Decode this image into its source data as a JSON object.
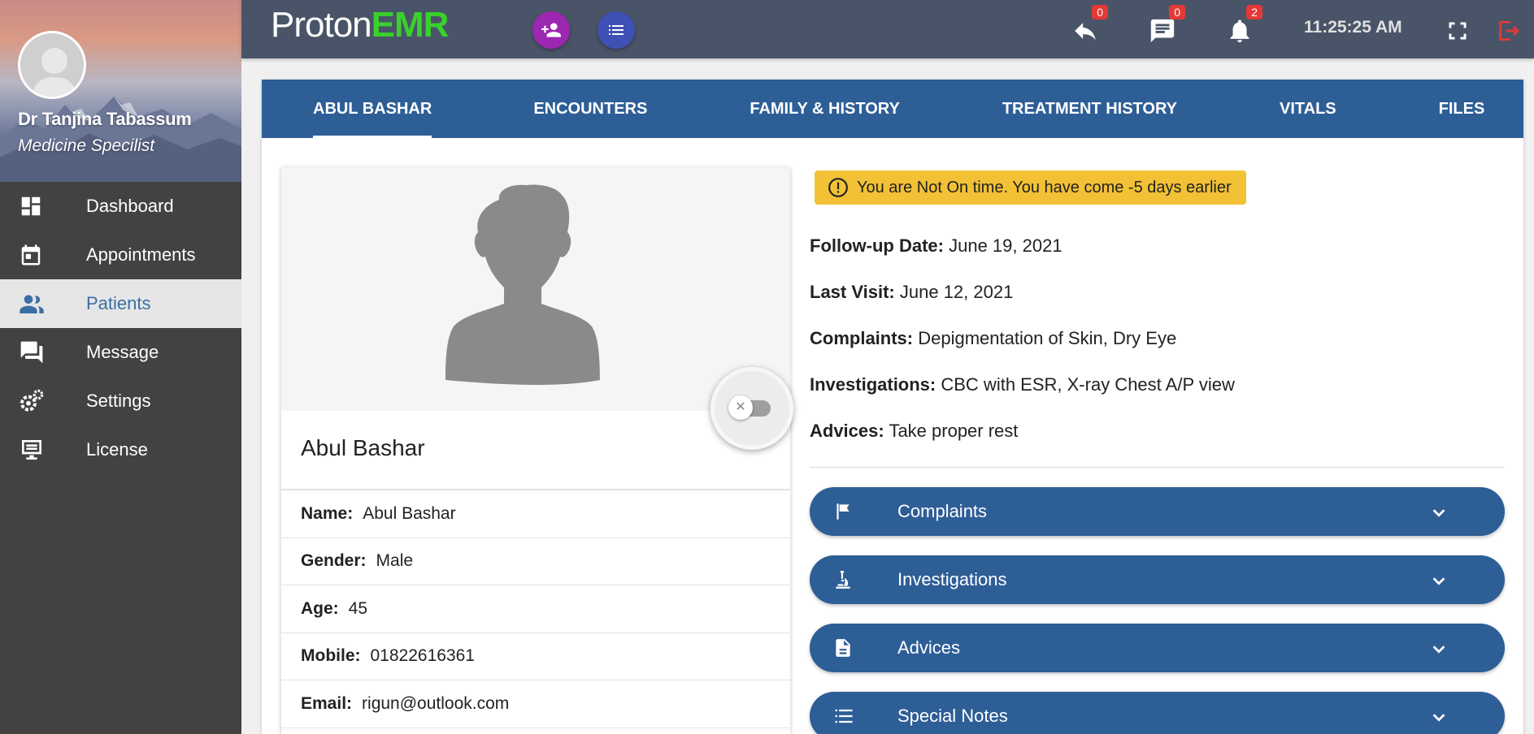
{
  "sidebar": {
    "doctor_name": "Dr Tanjina Tabassum",
    "doctor_role": "Medicine Specilist",
    "items": [
      {
        "label": "Dashboard",
        "icon": "dashboard-icon"
      },
      {
        "label": "Appointments",
        "icon": "calendar-icon"
      },
      {
        "label": "Patients",
        "icon": "people-icon",
        "active": true
      },
      {
        "label": "Message",
        "icon": "chat-icon"
      },
      {
        "label": "Settings",
        "icon": "gears-icon"
      },
      {
        "label": "License",
        "icon": "monitor-icon"
      }
    ]
  },
  "topbar": {
    "logo_part1": "Proton",
    "logo_part2": "EMR",
    "reply_count": "0",
    "message_count": "0",
    "notification_count": "2",
    "time": "11:25:25 AM"
  },
  "tabs": [
    "ABUL BASHAR",
    "ENCOUNTERS",
    "FAMILY & HISTORY",
    "TREATMENT HISTORY",
    "VITALS",
    "FILES"
  ],
  "patient": {
    "name": "Abul Bashar",
    "fields": [
      {
        "label": "Name:",
        "value": "Abul Bashar"
      },
      {
        "label": "Gender:",
        "value": "Male"
      },
      {
        "label": "Age:",
        "value": "45"
      },
      {
        "label": "Mobile:",
        "value": "01822616361"
      },
      {
        "label": "Email:",
        "value": "rigun@outlook.com"
      }
    ]
  },
  "alert": "You are Not On time. You have come -5 days earlier",
  "details": [
    {
      "label": "Follow-up Date:",
      "value": "June 19, 2021"
    },
    {
      "label": "Last Visit:",
      "value": "June 12, 2021"
    },
    {
      "label": "Complaints:",
      "value": "Depigmentation of Skin, Dry Eye"
    },
    {
      "label": "Investigations:",
      "value": "CBC with ESR, X-ray Chest A/P view"
    },
    {
      "label": "Advices:",
      "value": "Take proper rest"
    }
  ],
  "accordions": [
    {
      "label": "Complaints",
      "icon": "flag-icon"
    },
    {
      "label": "Investigations",
      "icon": "microscope-icon"
    },
    {
      "label": "Advices",
      "icon": "document-icon"
    },
    {
      "label": "Special Notes",
      "icon": "list-icon"
    }
  ],
  "colors": {
    "primary": "#2e5e96",
    "topbar": "#4a5468",
    "sidebar": "#424242",
    "alert": "#f2c135",
    "badge": "#e53935",
    "logo_accent": "#39d12b"
  }
}
